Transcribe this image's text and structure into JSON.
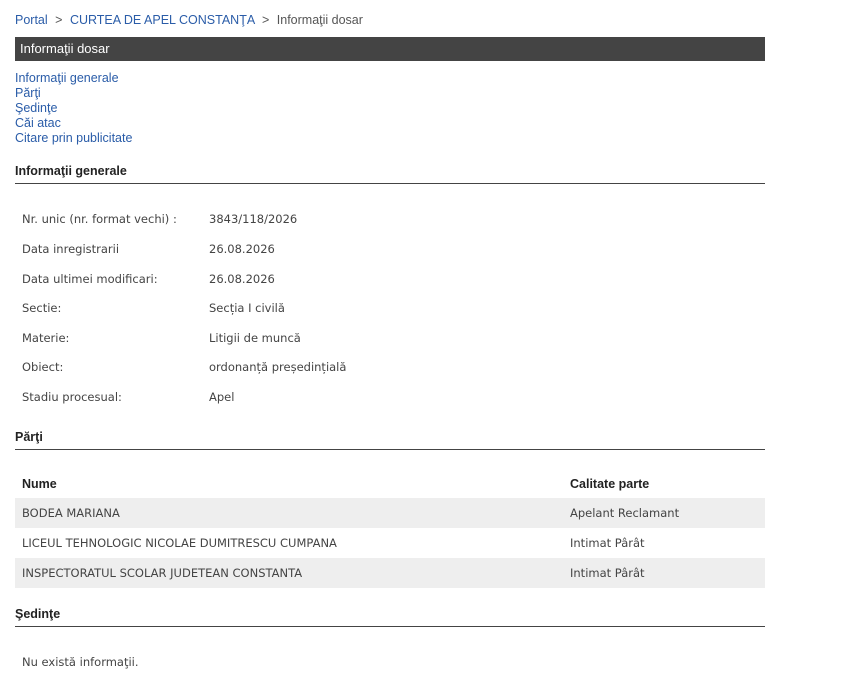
{
  "breadcrumb": {
    "items": [
      "Portal",
      "CURTEA DE APEL CONSTANŢA"
    ],
    "current": "Informaţii dosar",
    "separator": ">"
  },
  "title": "Informaţii dosar",
  "nav": {
    "links": [
      "Informaţii generale",
      "Părţi",
      "Şedinţe",
      "Căi atac",
      "Citare prin publicitate"
    ]
  },
  "general": {
    "heading": "Informaţii generale",
    "rows": [
      {
        "label": "Nr. unic (nr. format vechi) :",
        "value": "3843/118/2026"
      },
      {
        "label": "Data inregistrarii",
        "value": "26.08.2026"
      },
      {
        "label": "Data ultimei modificari:",
        "value": "26.08.2026"
      },
      {
        "label": "Sectie:",
        "value": "Secția I civilă"
      },
      {
        "label": "Materie:",
        "value": "Litigii de muncă"
      },
      {
        "label": "Obiect:",
        "value": "ordonanță președințială"
      },
      {
        "label": "Stadiu procesual:",
        "value": "Apel"
      }
    ]
  },
  "parti": {
    "heading": "Părţi",
    "columns": [
      "Nume",
      "Calitate parte"
    ],
    "rows": [
      {
        "nume": "BODEA MARIANA",
        "calitate": "Apelant Reclamant"
      },
      {
        "nume": "LICEUL TEHNOLOGIC NICOLAE DUMITRESCU CUMPANA",
        "calitate": "Intimat Pârât"
      },
      {
        "nume": "INSPECTORATUL SCOLAR JUDETEAN CONSTANTA",
        "calitate": "Intimat Pârât"
      }
    ]
  },
  "sedinte": {
    "heading": "Şedinţe",
    "empty_text": "Nu există informaţii."
  },
  "colors": {
    "link": "#2a5ca8",
    "title_bar": "#444444",
    "row_stripe": "#eeeeee"
  }
}
